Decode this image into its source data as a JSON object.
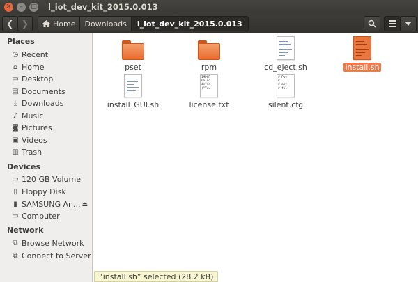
{
  "window": {
    "title": "l_iot_dev_kit_2015.0.013"
  },
  "toolbar": {
    "back_glyph": "❮",
    "forward_glyph": "❯",
    "breadcrumbs": [
      "Home",
      "Downloads",
      "l_iot_dev_kit_2015.0.013"
    ],
    "search_icon": "search-icon",
    "list_icon": "list-view-icon",
    "menu_icon": "menu-icon"
  },
  "sidebar": {
    "places_title": "Places",
    "places": [
      {
        "label": "Recent",
        "icon": "clock-icon"
      },
      {
        "label": "Home",
        "icon": "home-icon"
      },
      {
        "label": "Desktop",
        "icon": "desktop-icon"
      },
      {
        "label": "Documents",
        "icon": "documents-icon"
      },
      {
        "label": "Downloads",
        "icon": "downloads-icon"
      },
      {
        "label": "Music",
        "icon": "music-icon"
      },
      {
        "label": "Pictures",
        "icon": "pictures-icon"
      },
      {
        "label": "Videos",
        "icon": "videos-icon"
      },
      {
        "label": "Trash",
        "icon": "trash-icon"
      }
    ],
    "devices_title": "Devices",
    "devices": [
      {
        "label": "120 GB Volume",
        "icon": "drive-icon"
      },
      {
        "label": "Floppy Disk",
        "icon": "floppy-icon"
      },
      {
        "label": "SAMSUNG An...",
        "icon": "usb-drive-icon"
      },
      {
        "label": "Computer",
        "icon": "computer-icon"
      }
    ],
    "network_title": "Network",
    "network": [
      {
        "label": "Browse Network",
        "icon": "network-icon"
      },
      {
        "label": "Connect to Server",
        "icon": "server-icon"
      }
    ]
  },
  "files": [
    {
      "name": "pset",
      "type": "folder"
    },
    {
      "name": "rpm",
      "type": "folder"
    },
    {
      "name": "cd_eject.sh",
      "type": "script"
    },
    {
      "name": "install.sh",
      "type": "script",
      "selected": true
    },
    {
      "name": "install_GUI.sh",
      "type": "script"
    },
    {
      "name": "license.txt",
      "type": "text",
      "preview": "IMPOR\nDo no\ndefin\n(\"You"
    },
    {
      "name": "silent.cfg",
      "type": "text",
      "preview": "# Pat\n#\n# any\n# fil"
    }
  ],
  "status": {
    "text": "“install.sh” selected  (28.2 kB)"
  },
  "colors": {
    "accent": "#f07746",
    "folder": "#e96b31",
    "status_bg": "#f7f6d0"
  }
}
